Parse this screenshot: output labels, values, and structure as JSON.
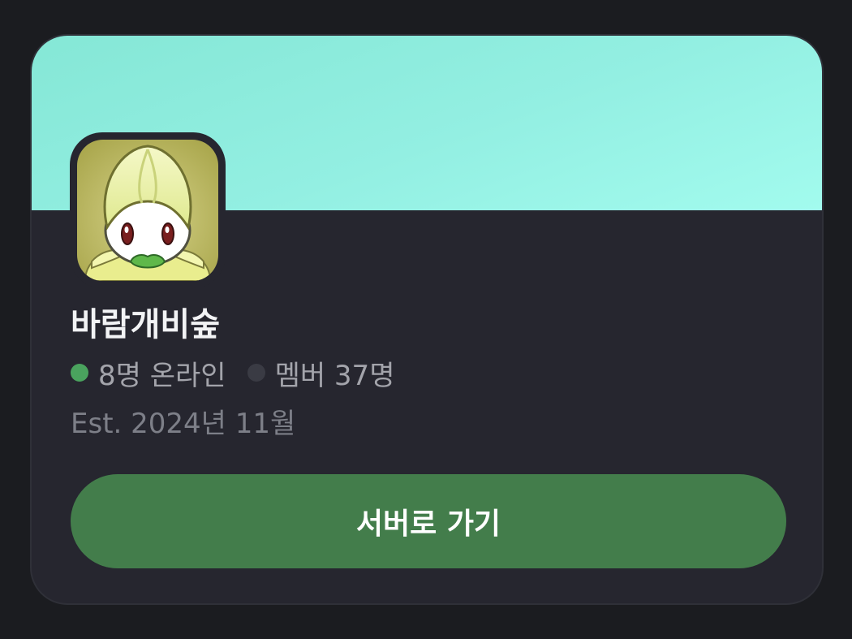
{
  "server": {
    "name": "바람개비숲",
    "online_text": "8명 온라인",
    "members_text": "멤버 37명",
    "established": "Est. 2024년 11월",
    "avatar_icon": "pokemon-petilil-avatar-icon"
  },
  "actions": {
    "go_to_server_label": "서버로 가기"
  },
  "colors": {
    "banner": "#8feade",
    "card_background": "#26262f",
    "online_dot": "#4aa35e",
    "button": "#437d4b"
  }
}
